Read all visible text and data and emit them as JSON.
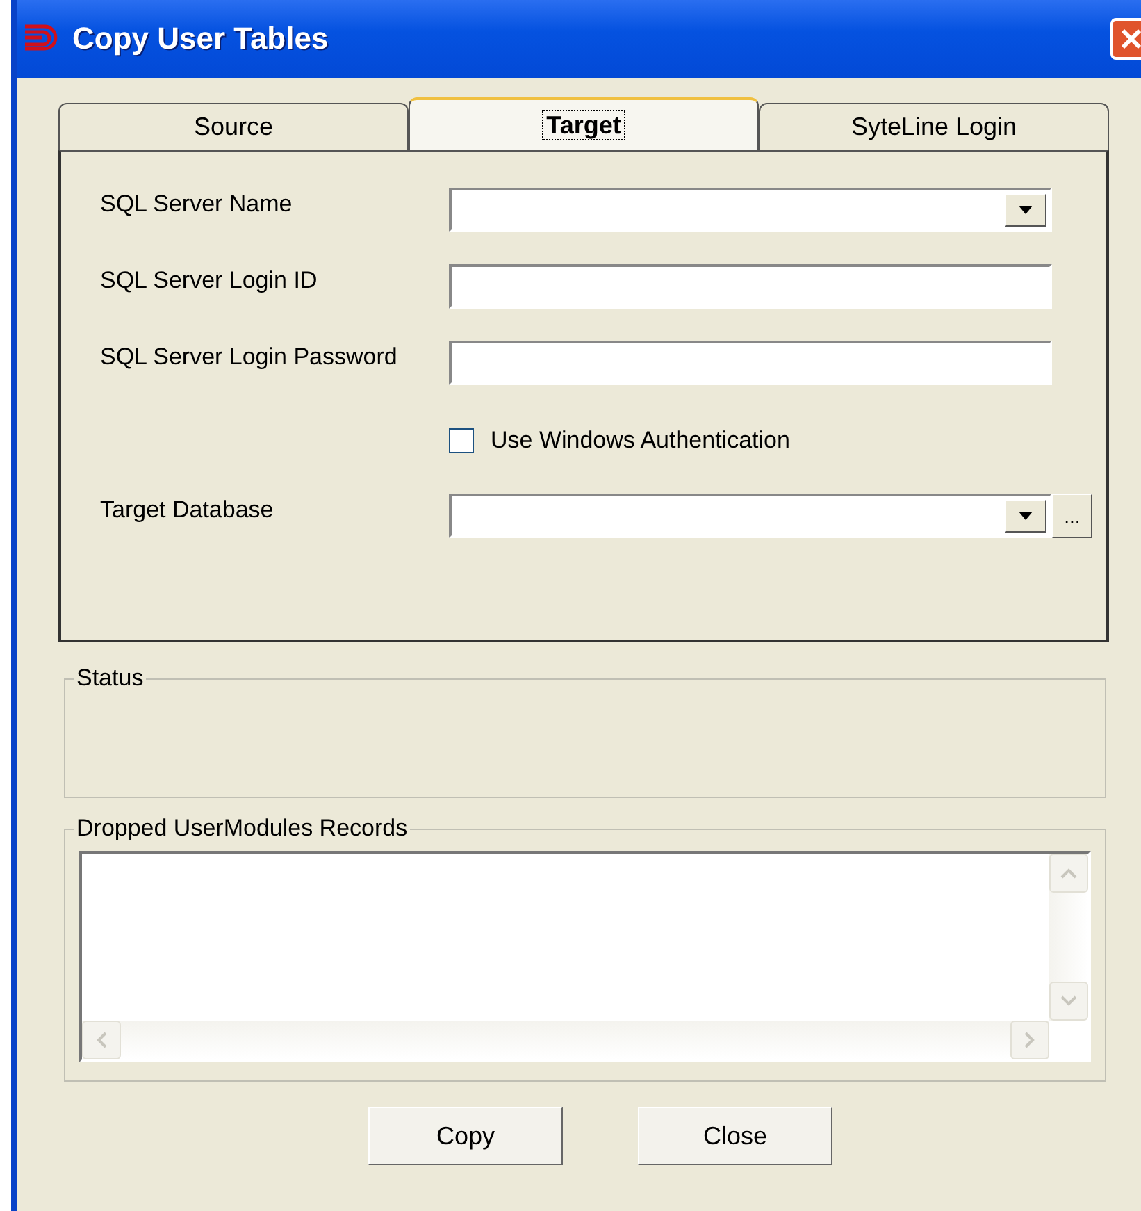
{
  "window": {
    "title": "Copy User Tables"
  },
  "tabs": [
    {
      "label": "Source",
      "selected": false
    },
    {
      "label": "Target",
      "selected": true
    },
    {
      "label": "SyteLine Login",
      "selected": false
    }
  ],
  "fields": [
    {
      "kind": "combo",
      "label": "SQL Server Name"
    },
    {
      "kind": "text",
      "label": "SQL Server Login ID"
    },
    {
      "kind": "text",
      "label": "SQL Server Login Password"
    },
    {
      "kind": "checkbox",
      "label": "Use Windows Authentication",
      "checked": false
    },
    {
      "kind": "combo_browse",
      "label": "Target Database",
      "browse": "..."
    }
  ],
  "status": {
    "label": "Status"
  },
  "records": {
    "label": "Dropped UserModules Records"
  },
  "buttons": [
    "Copy",
    "Close"
  ]
}
